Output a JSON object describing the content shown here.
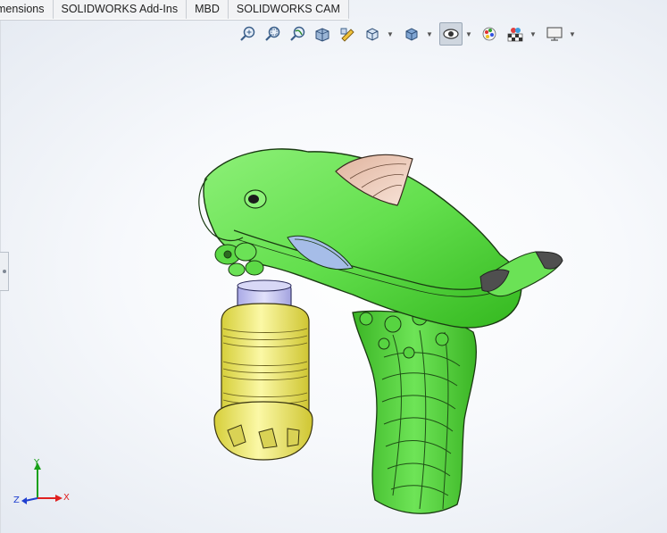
{
  "tabs": [
    {
      "label": "mensions"
    },
    {
      "label": "SOLIDWORKS Add-Ins"
    },
    {
      "label": "MBD"
    },
    {
      "label": "SOLIDWORKS CAM"
    }
  ],
  "heads_up_toolbar": {
    "buttons": [
      {
        "icon": "zoom-to-fit-icon"
      },
      {
        "icon": "zoom-to-area-icon"
      },
      {
        "icon": "previous-view-icon"
      },
      {
        "icon": "section-view-icon"
      },
      {
        "icon": "dynamic-annotation-views-icon"
      },
      {
        "icon": "view-orientation-icon"
      },
      {
        "icon": "display-style-icon"
      },
      {
        "icon": "hide-show-items-icon"
      },
      {
        "icon": "edit-appearance-icon"
      },
      {
        "icon": "apply-scene-icon"
      },
      {
        "icon": "view-settings-icon"
      }
    ]
  },
  "triad": {
    "x_label": "X",
    "y_label": "Y",
    "z_label": "Z",
    "colors": {
      "x": "#e02020",
      "y": "#18a018",
      "z": "#2040d0"
    }
  },
  "model": {
    "body_color": "#6fe35a",
    "body_shade": "#3fbf2c",
    "canister_color": "#f3ef7a",
    "cap_color": "#c9c9f2",
    "fin_color": "#f1d3c3",
    "tip_color": "#555555"
  }
}
